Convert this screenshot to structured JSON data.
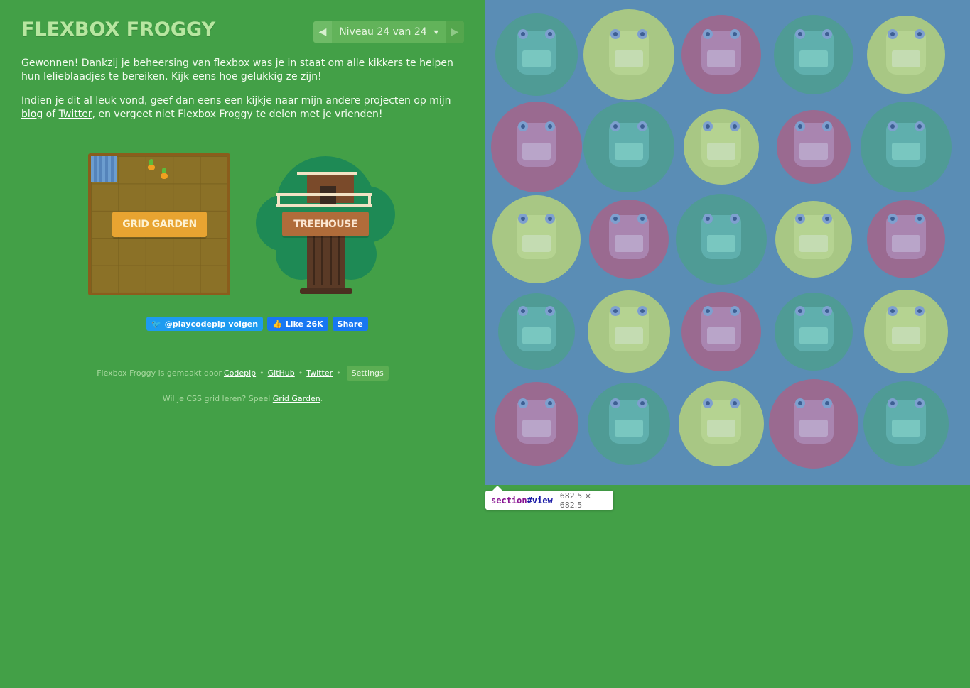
{
  "header": {
    "title": "FLEXBOX FROGGY",
    "prev_icon": "triangle-left-icon",
    "next_icon": "triangle-right-icon",
    "level_label": "Niveau 24 van 24",
    "caret_icon": "caret-down-icon"
  },
  "intro": {
    "won_text": "Gewonnen! Dankzij je beheersing van flexbox was je in staat om alle kikkers te helpen hun lelieblaadjes te bereiken. Kijk eens hoe gelukkig ze zijn!",
    "p2_before": "Indien je dit al leuk vond, geef dan eens een kijkje naar mijn andere projecten op mijn ",
    "p2_blog": "blog",
    "p2_of": " of ",
    "p2_twitter": "Twitter",
    "p2_after": ", en vergeet niet Flexbox Froggy te delen met je vrienden!"
  },
  "projects": {
    "grid_garden": "GRID GARDEN",
    "treehouse": "TREEHOUSE"
  },
  "social": {
    "twitter_follow": "@playcodepip volgen",
    "fb_like": "Like 26K",
    "fb_share": "Share"
  },
  "footer": {
    "made_by": "Flexbox Froggy is gemaakt door",
    "codepip": "Codepip",
    "github": "GitHub",
    "twitter": "Twitter",
    "separator": "•",
    "settings": "Settings",
    "promo_before": "Wil je CSS grid leren? Speel ",
    "promo_link": "Grid Garden",
    "promo_after": "."
  },
  "board": {
    "colors": {
      "green": "#a8c784",
      "red": "#9a6a90",
      "blue": "#4f9b95",
      "background": "#5a8db5"
    },
    "pads": [
      [
        "blue",
        "green",
        "red",
        "blue",
        "green"
      ],
      [
        "red",
        "blue",
        "green",
        "red",
        "blue"
      ],
      [
        "green",
        "red",
        "blue",
        "green",
        "red"
      ],
      [
        "blue",
        "green",
        "red",
        "blue",
        "green"
      ],
      [
        "red",
        "blue",
        "green",
        "red",
        "blue"
      ]
    ]
  },
  "tooltip": {
    "tag": "section",
    "id": "#view",
    "size": "682.5 × 682.5"
  },
  "colors": {
    "page_background": "#43a047",
    "title": "#b8e6a0"
  }
}
